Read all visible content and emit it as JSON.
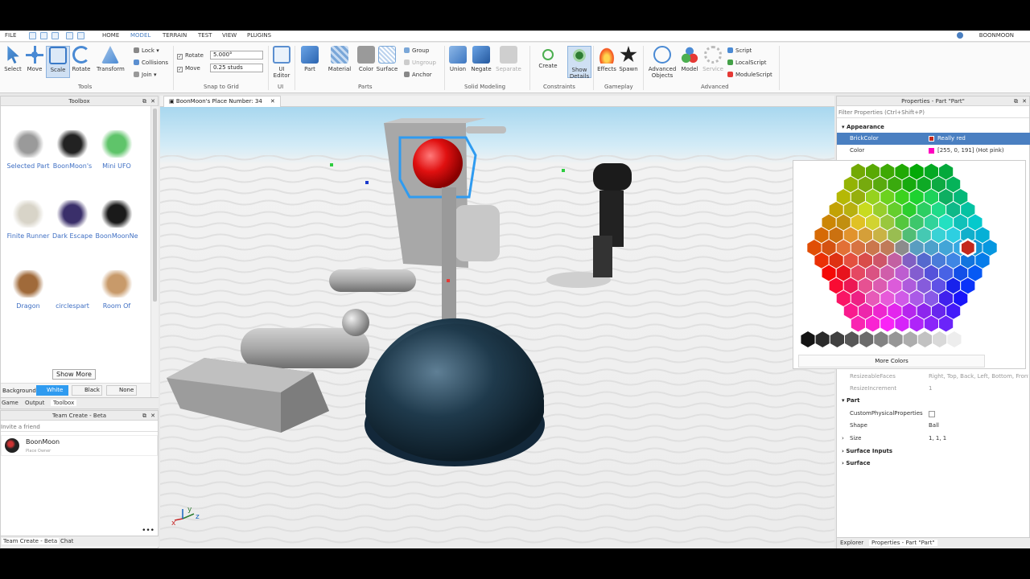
{
  "menubar": {
    "file": "FILE",
    "tabs": [
      "HOME",
      "MODEL",
      "TERRAIN",
      "TEST",
      "VIEW",
      "PLUGINS"
    ],
    "active_tab": "MODEL",
    "user": "BOONMOON"
  },
  "ribbon": {
    "tools": [
      "Select",
      "Move",
      "Scale",
      "Rotate",
      "Transform"
    ],
    "lock": "Lock",
    "collisions": "Collisions",
    "join": "Join",
    "rotate_label": "Rotate",
    "rotate_value": "5.000°",
    "move_label": "Move",
    "move_value": "0.25 studs",
    "ui_editor": [
      "UI",
      "Editor"
    ],
    "part": "Part",
    "material": "Material",
    "color": "Color",
    "surface": "Surface",
    "group": "Group",
    "ungroup": "Ungroup",
    "anchor": "Anchor",
    "union": "Union",
    "negate": "Negate",
    "separate": "Separate",
    "create": "Create",
    "show_details": [
      "Show",
      "Details"
    ],
    "effects": "Effects",
    "spawn": "Spawn",
    "advanced_objects": [
      "Advanced",
      "Objects"
    ],
    "model": "Model",
    "service": "Service",
    "script": "Script",
    "localscript": "LocalScript",
    "modulescript": "ModuleScript",
    "groups": [
      "Tools",
      "Snap to Grid",
      "UI",
      "Parts",
      "Solid Modeling",
      "Constraints",
      "Gameplay",
      "Advanced"
    ]
  },
  "toolbox": {
    "title": "Toolbox",
    "items": [
      {
        "name": "Selected Part",
        "color": "#9a9a9a"
      },
      {
        "name": "BoonMoon's",
        "color": "#222222"
      },
      {
        "name": "Mini UFO",
        "color": "#5fc46a"
      },
      {
        "name": "Finite Runner",
        "color": "#d8d4c8"
      },
      {
        "name": "Dark Escape",
        "color": "#3a2f6a"
      },
      {
        "name": "BoonMoonNe",
        "color": "#1a1a1a"
      },
      {
        "name": "Dragon",
        "color": "#a06a3a"
      },
      {
        "name": "circlespart",
        "color": "#ffffff"
      },
      {
        "name": "Room Of",
        "color": "#c89a6a"
      }
    ],
    "show_more": "Show More",
    "background_label": "Background:",
    "bg_options": [
      "White",
      "Black",
      "None"
    ],
    "tabs": [
      "Game",
      "Output",
      "Toolbox"
    ]
  },
  "team_create": {
    "title": "Team Create - Beta",
    "invite_placeholder": "Invite a friend",
    "user_name": "BoonMoon",
    "user_role": "Place Owner",
    "tabs": [
      "Team Create - Beta",
      "Chat"
    ]
  },
  "viewport": {
    "tab_title": "BoonMoon's Place Number: 34",
    "axis_x": "x",
    "axis_y": "y",
    "axis_z": "z"
  },
  "properties": {
    "title": "Properties - Part \"Part\"",
    "filter_placeholder": "Filter Properties (Ctrl+Shift+P)",
    "appearance": "Appearance",
    "brickcolor_name": "BrickColor",
    "brickcolor_value": "Really red",
    "color_name": "Color",
    "color_value": "[255, 0, 191] (Hot pink)",
    "more_colors": "More Colors",
    "resizeable_faces_name": "ResizeableFaces",
    "resizeable_faces_value": "Right, Top, Back, Left, Bottom, Front",
    "resize_increment_name": "ResizeIncrement",
    "resize_increment_value": "1",
    "part_section": "Part",
    "custom_phys": "CustomPhysicalProperties",
    "shape_name": "Shape",
    "shape_value": "Ball",
    "size_name": "Size",
    "size_value": "1, 1, 1",
    "surface_inputs": "Surface Inputs",
    "surface": "Surface",
    "tabs": [
      "Explorer",
      "Properties - Part \"Part\""
    ]
  },
  "colors": {
    "selection": "#2f9bf0",
    "accent": "#4a7fc1",
    "brick_red": "#c4281c",
    "hot_pink": "#ff00bf"
  }
}
